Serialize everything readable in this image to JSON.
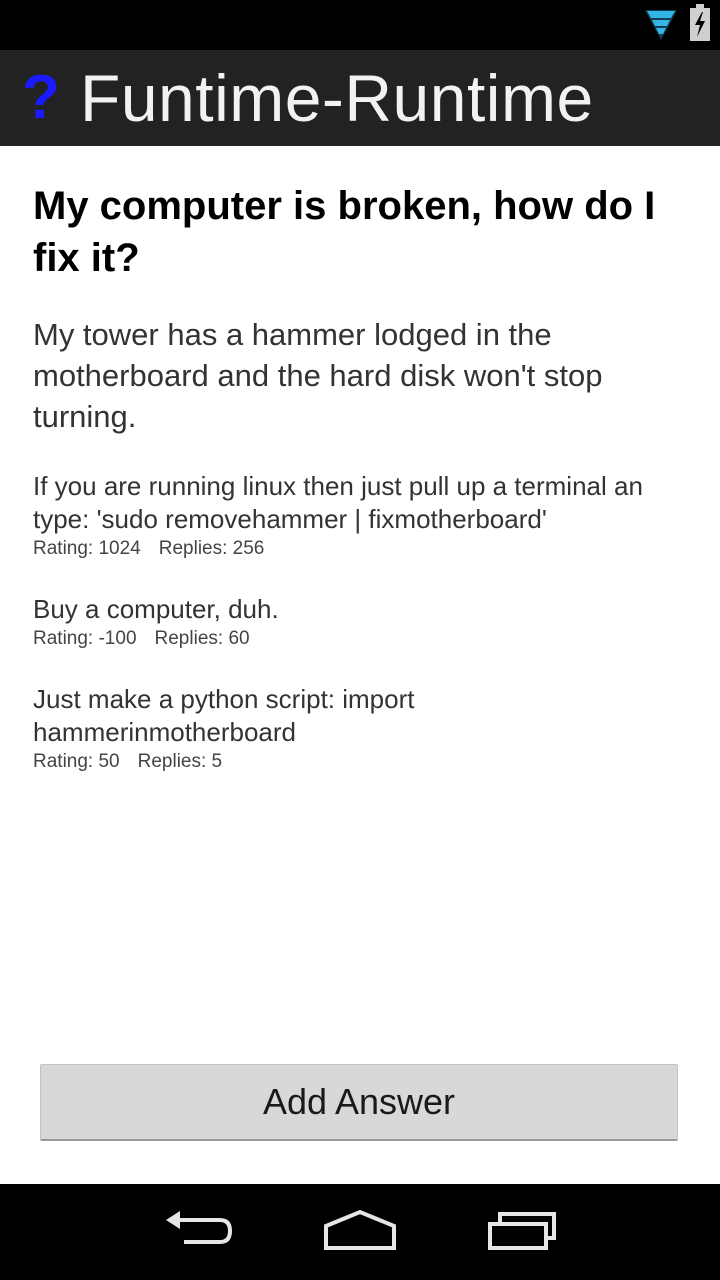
{
  "app": {
    "title": "Funtime-Runtime",
    "icon_glyph": "?",
    "icon_color": "#1a1aff"
  },
  "status_bar": {
    "icons": [
      "wifi-signal-icon",
      "battery-charging-icon"
    ]
  },
  "question": {
    "title": "My computer is broken, how do I fix it?",
    "body": "My tower has a hammer lodged in the motherboard and the hard disk won't stop turning."
  },
  "answers": [
    {
      "line1": "If you are running linux then just pull up a terminal an",
      "line2": "type: 'sudo removehammer | fixmotherboard'",
      "rating": "Rating: 1024",
      "replies": "Replies: 256"
    },
    {
      "text": "Buy a computer, duh.",
      "rating": "Rating: -100",
      "replies": "Replies: 60"
    },
    {
      "text": "Just make a python script: import hammerinmotherboard",
      "rating": "Rating: 50",
      "replies": "Replies: 5"
    }
  ],
  "add_answer_button": {
    "label": "Add Answer"
  },
  "nav_bar": {
    "buttons": [
      "back-icon",
      "home-icon",
      "recent-apps-icon"
    ]
  }
}
